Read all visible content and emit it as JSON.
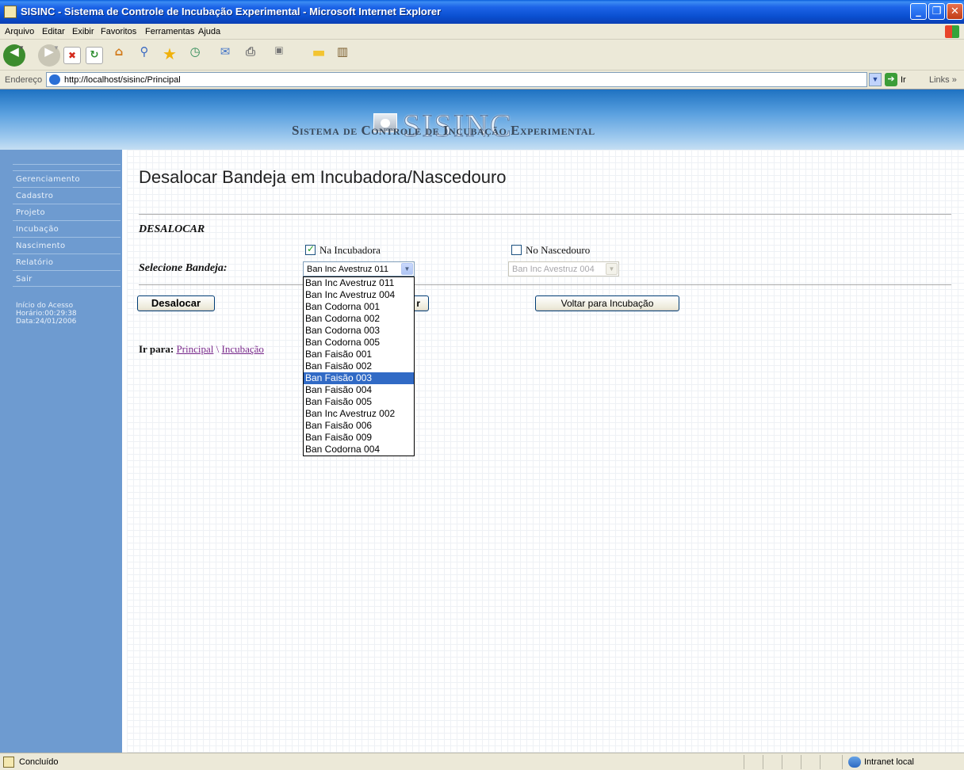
{
  "window": {
    "title": "SISINC - Sistema de Controle de Incubação Experimental - Microsoft Internet Explorer",
    "controls": [
      "_",
      "❐",
      "✕"
    ]
  },
  "menubar": [
    "Arquivo",
    "Editar",
    "Exibir",
    "Favoritos",
    "Ferramentas",
    "Ajuda"
  ],
  "toolbar": {
    "icons": [
      "back-icon",
      "forward-icon",
      "stop-icon",
      "refresh-icon",
      "home-icon",
      "search-icon",
      "favorites-icon",
      "history-icon",
      "mail-icon",
      "print-icon",
      "edit-icon",
      "folder-icon",
      "research-icon"
    ]
  },
  "addressbar": {
    "label": "Endereço",
    "url": "http://localhost/sisinc/Principal",
    "go_label": "Ir",
    "links_label": "Links »"
  },
  "header": {
    "logo": "SISINC",
    "subtitle": "Sistema de Controle de Incubação Experimental"
  },
  "sidebar": {
    "items": [
      "Gerenciamento",
      "Cadastro",
      "Projeto",
      "Incubação",
      "Nascimento",
      "Relatório",
      "Sair"
    ],
    "access": {
      "line1": "Início do Acesso",
      "line2": "Horário:00:29:38",
      "line3": "Data:24/01/2006"
    }
  },
  "main": {
    "title": "Desalocar Bandeja em Incubadora/Nascedouro",
    "section": "DESALOCAR",
    "checkbox_incubadora": {
      "label": "Na Incubadora",
      "checked": true
    },
    "checkbox_nascedouro": {
      "label": "No Nascedouro",
      "checked": false
    },
    "select_label": "Selecione Bandeja:",
    "select_incubadora_value": "Ban Inc Avestruz 011",
    "select_nascedouro_value": "Ban Inc Avestruz 004",
    "btn_desalocar": "Desalocar",
    "btn_hidden_partial": "r",
    "btn_voltar": "Voltar para Incubação",
    "goto_label": "Ir para",
    "goto_link1": "Principal",
    "goto_sep": "\\",
    "goto_link2": "Incubação"
  },
  "dropdown": {
    "options": [
      "Ban Inc Avestruz 011",
      "Ban Inc Avestruz 004",
      "Ban Codorna 001",
      "Ban Codorna 002",
      "Ban Codorna 003",
      "Ban Codorna 005",
      "Ban Faisão 001",
      "Ban Faisão 002",
      "Ban Faisão 003",
      "Ban Faisão 004",
      "Ban Faisão 005",
      "Ban Inc Avestruz 002",
      "Ban Faisão 006",
      "Ban Faisão 009",
      "Ban Codorna 004"
    ],
    "selected_index": 8
  },
  "statusbar": {
    "text": "Concluído",
    "zone": "Intranet local"
  },
  "colors": {
    "sidebar": "#6e9bd0",
    "selection": "#316ac5",
    "xp_blue": "#0a4fd0"
  }
}
